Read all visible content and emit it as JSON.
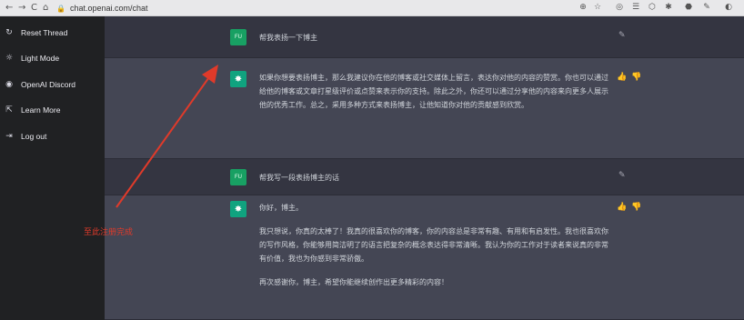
{
  "browser": {
    "url": "chat.openai.com/chat",
    "nav_back": "←",
    "nav_forward": "→",
    "nav_reload": "C",
    "nav_home": "⌂",
    "lock": "🔒",
    "extensions": [
      "⊕",
      "☆",
      "◎",
      "☰",
      "⬡",
      "✱",
      "⬣",
      "✎",
      "◐"
    ]
  },
  "sidebar": {
    "items": [
      {
        "icon": "reset-icon",
        "glyph": "↻",
        "label": "Reset Thread"
      },
      {
        "icon": "sun-icon",
        "glyph": "☼",
        "label": "Light Mode"
      },
      {
        "icon": "discord-icon",
        "glyph": "◉",
        "label": "OpenAI Discord"
      },
      {
        "icon": "external-link-icon",
        "glyph": "⇱",
        "label": "Learn More"
      },
      {
        "icon": "logout-icon",
        "glyph": "⇥",
        "label": "Log out"
      }
    ]
  },
  "conversation": [
    {
      "role": "user",
      "avatar": "FU",
      "text": "帮我表扬一下博主"
    },
    {
      "role": "assistant",
      "avatar": "✸",
      "paragraphs": [
        "如果你想要表扬博主，那么我建议你在他的博客或社交媒体上留言，表达你对他的内容的赞赏。你也可以通过给他的博客或文章打星级评价或点赞来表示你的支持。除此之外，你还可以通过分享他的内容来向更多人展示他的优秀工作。总之，采用多种方式来表扬博主，让他知道你对他的贡献感到欣赏。"
      ]
    },
    {
      "role": "user",
      "avatar": "FU",
      "text": "帮我写一段表扬博主的话"
    },
    {
      "role": "assistant",
      "avatar": "✸",
      "paragraphs": [
        "你好，博主。",
        "我只想说，你真的太棒了！我真的很喜欢你的博客，你的内容总是非常有趣、有用和有启发性。我也很喜欢你的写作风格，你能够用简洁明了的语言把复杂的概念表达得非常清晰。我认为你的工作对于读者来说真的非常有价值，我也为你感到非常骄傲。",
        "再次感谢你，博主，希望你能继续创作出更多精彩的内容！"
      ]
    }
  ],
  "actions": {
    "edit": "✎",
    "thumbs_up": "👍",
    "thumbs_down": "👎"
  },
  "annotation": {
    "text": "至此注册完成",
    "color": "#e03a2a"
  }
}
